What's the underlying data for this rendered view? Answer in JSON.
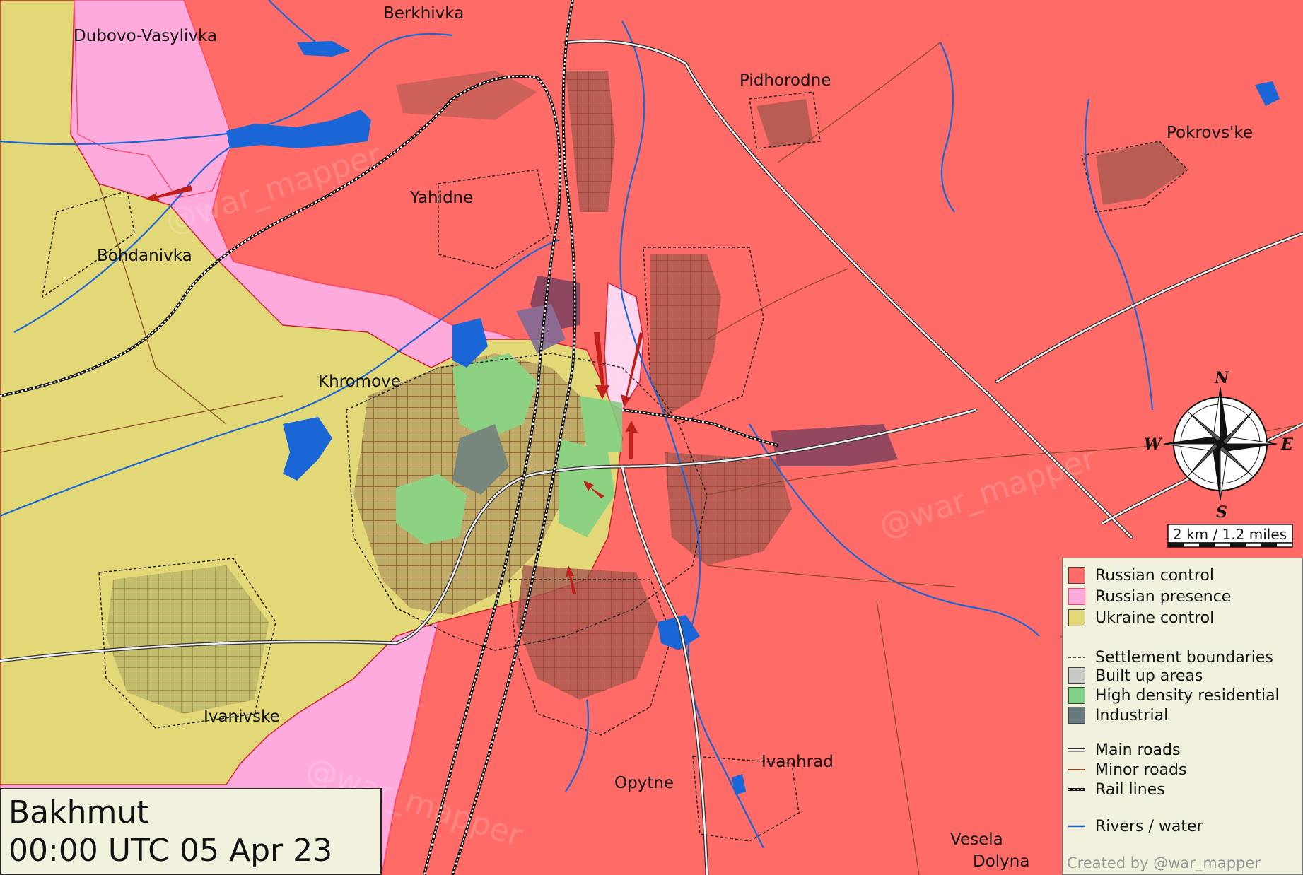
{
  "title": {
    "line1": "Bakhmut",
    "line2": "00:00 UTC 05 Apr 23"
  },
  "places": [
    {
      "key": "berkhivka",
      "label": "Berkhivka"
    },
    {
      "key": "dubovo",
      "label": "Dubovo-Vasylivka"
    },
    {
      "key": "pidhorodne",
      "label": "Pidhorodne"
    },
    {
      "key": "pokrovske",
      "label": "Pokrovs'ke"
    },
    {
      "key": "yahidne",
      "label": "Yahidne"
    },
    {
      "key": "bohdanivka",
      "label": "Bohdanivka"
    },
    {
      "key": "khromove",
      "label": "Khromove"
    },
    {
      "key": "ivanivske",
      "label": "Ivanivske"
    },
    {
      "key": "ivanhrad",
      "label": "Ivanhrad"
    },
    {
      "key": "opytne",
      "label": "Opytne"
    },
    {
      "key": "vesela1",
      "label": "Vesela"
    },
    {
      "key": "vesela2",
      "label": "Dolyna"
    }
  ],
  "scale": {
    "label": "2 km / 1.2 miles"
  },
  "compass": {
    "n": "N",
    "s": "S",
    "e": "E",
    "w": "W"
  },
  "watermark": "@war_mapper",
  "colors": {
    "russian_control": "#ff6b66",
    "russian_presence": "#ffaadd",
    "ukraine_control": "#e2d877",
    "built_up": "#c8c8c8",
    "high_density": "#7fd186",
    "industrial": "#667a7e",
    "river": "#1a66d6",
    "minor_road": "#8a4a2a"
  },
  "legend": {
    "items": [
      {
        "label": "Russian control"
      },
      {
        "label": "Russian presence"
      },
      {
        "label": "Ukraine control"
      },
      {
        "label": "Settlement boundaries"
      },
      {
        "label": "Built up areas"
      },
      {
        "label": "High density residential"
      },
      {
        "label": "Industrial"
      },
      {
        "label": "Main roads"
      },
      {
        "label": "Minor roads"
      },
      {
        "label": "Rail lines"
      },
      {
        "label": "Rivers / water"
      }
    ],
    "credit": "Created by @war_mapper"
  }
}
